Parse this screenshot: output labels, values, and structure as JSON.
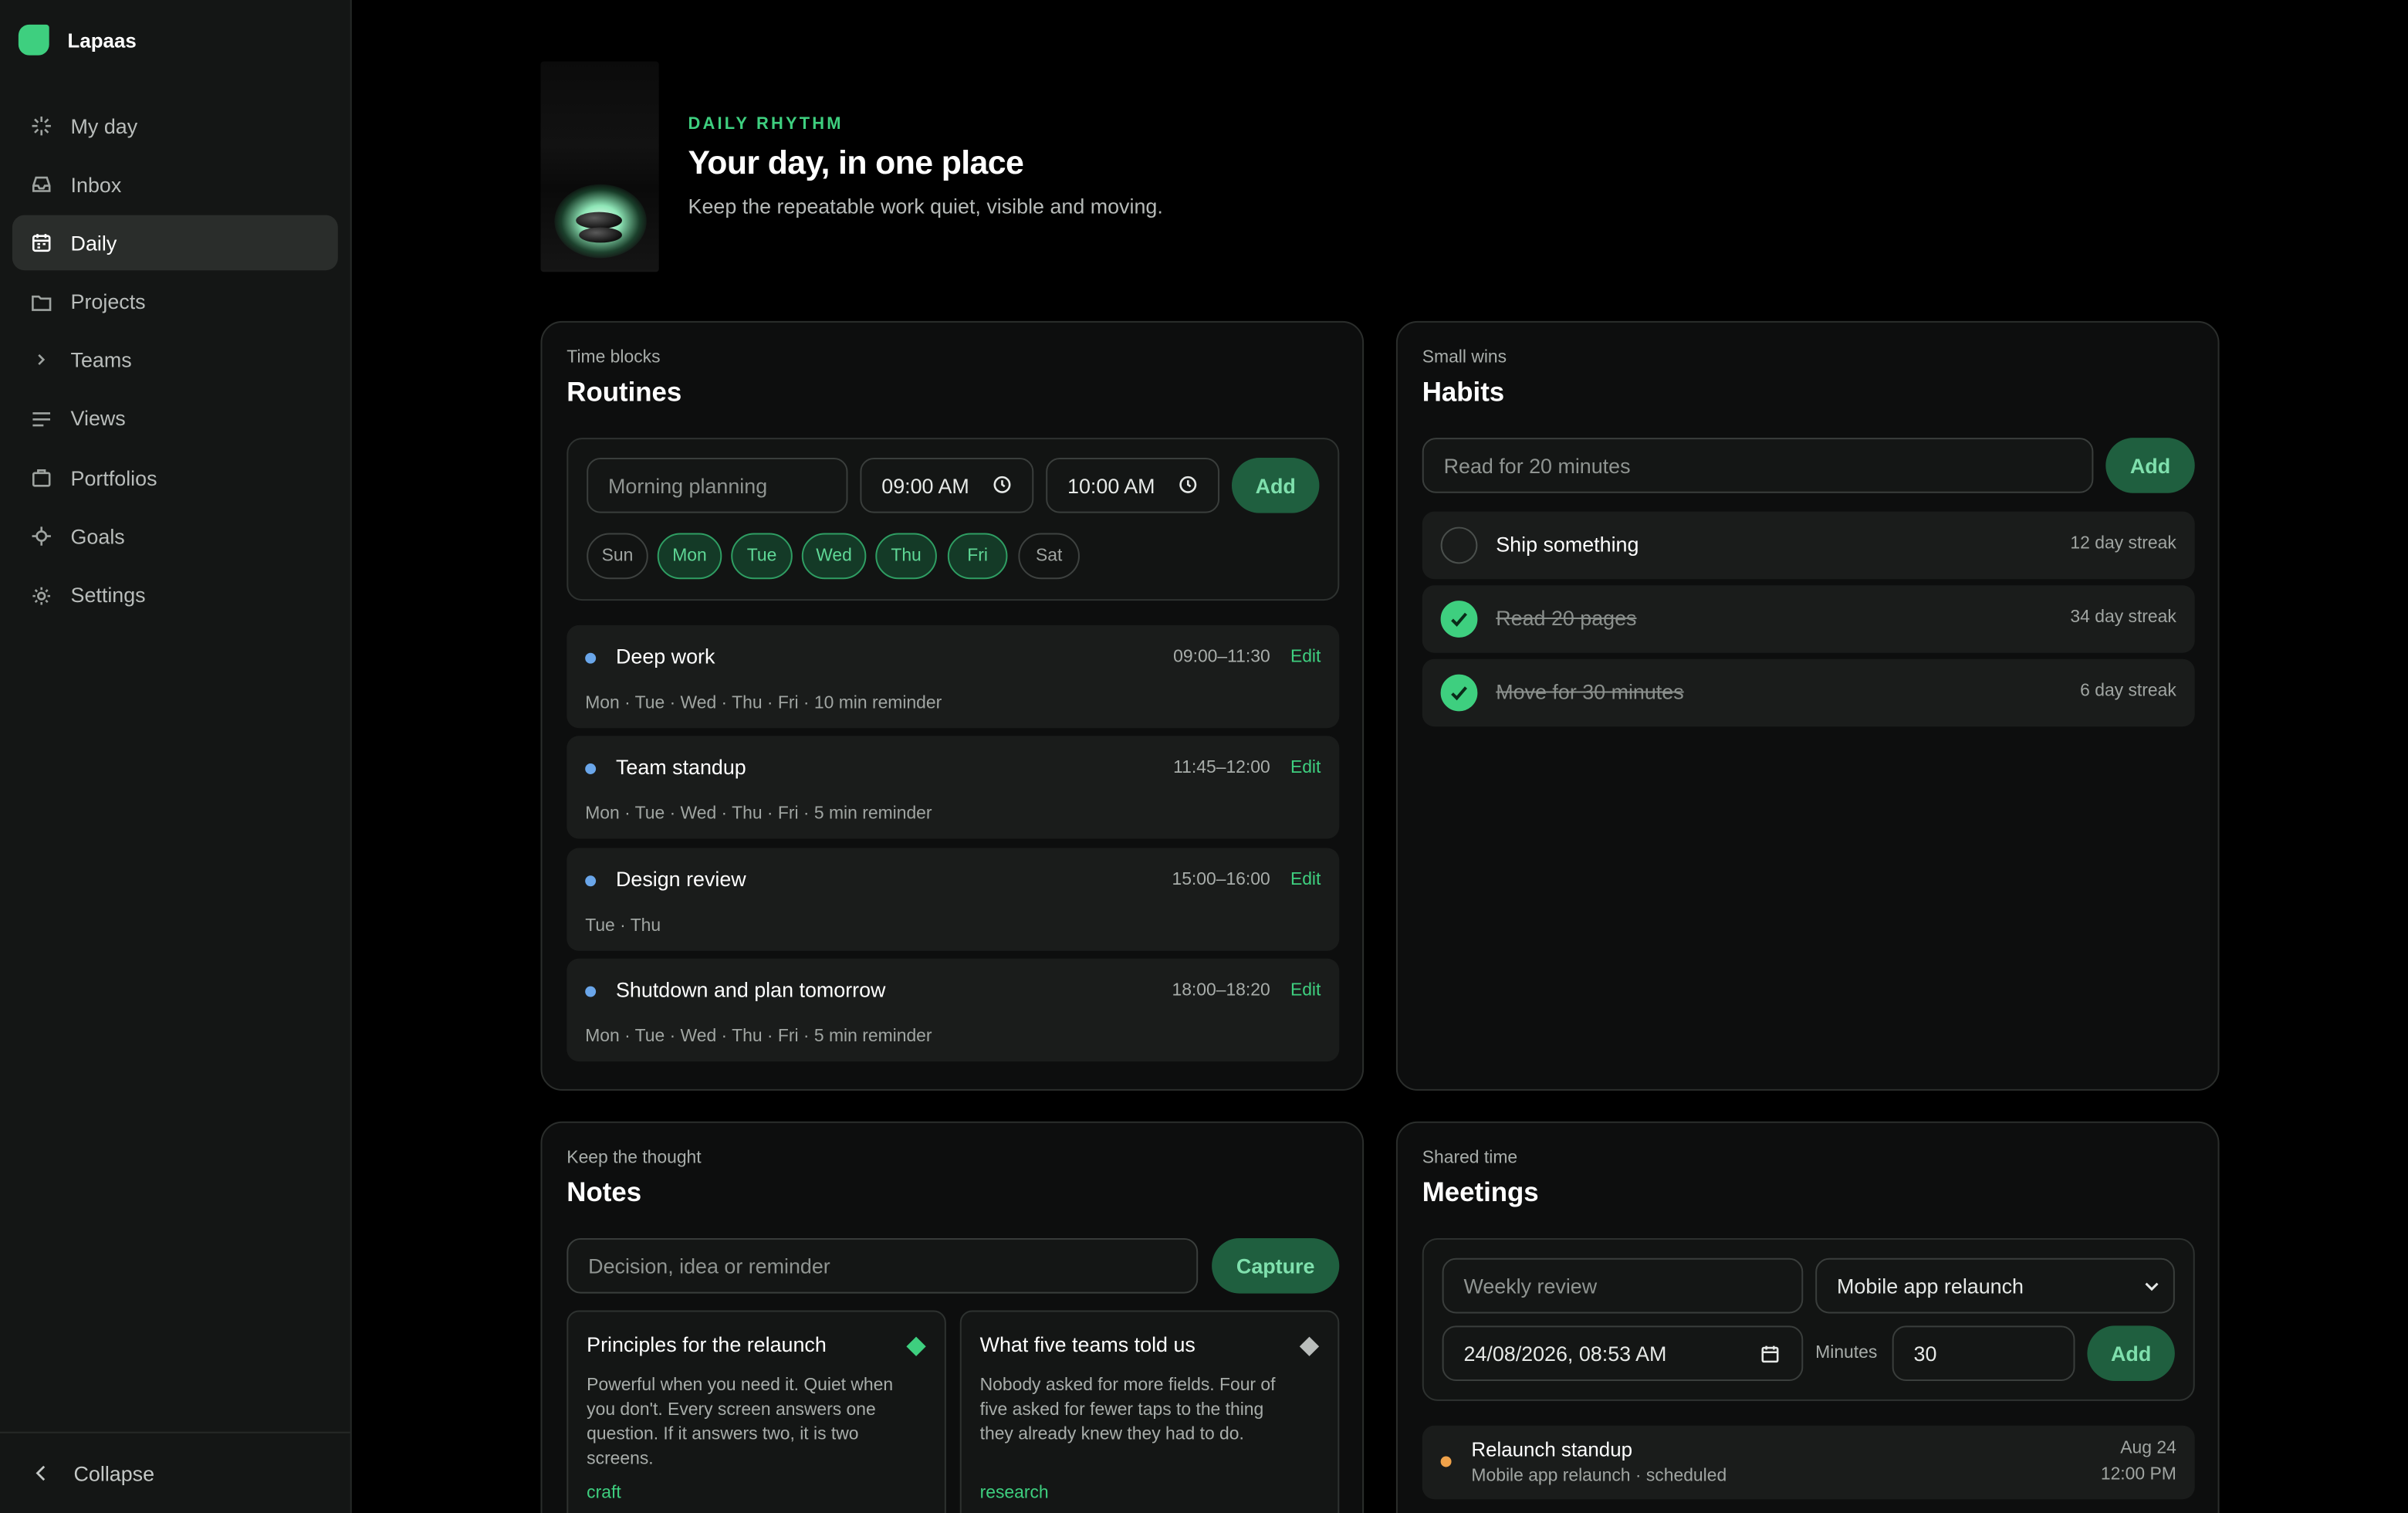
{
  "brand": {
    "name": "Lapaas"
  },
  "nav": [
    {
      "label": "My day",
      "icon": "sparkle-icon"
    },
    {
      "label": "Inbox",
      "icon": "inbox-icon"
    },
    {
      "label": "Daily",
      "icon": "calendar-icon",
      "active": true
    },
    {
      "label": "Projects",
      "icon": "folder-icon"
    },
    {
      "label": "Teams",
      "icon": "chevron-right-icon"
    },
    {
      "label": "Views",
      "icon": "lines-icon"
    },
    {
      "label": "Portfolios",
      "icon": "briefcase-icon"
    },
    {
      "label": "Goals",
      "icon": "target-icon"
    },
    {
      "label": "Settings",
      "icon": "gear-icon"
    }
  ],
  "collapse_label": "Collapse",
  "hero": {
    "eyebrow": "DAILY RHYTHM",
    "title": "Your day, in one place",
    "subtitle": "Keep the repeatable work quiet, visible and moving."
  },
  "routines": {
    "kicker": "Time blocks",
    "title": "Routines",
    "name_placeholder": "Morning planning",
    "start": "09:00 AM",
    "end": "10:00 AM",
    "add_label": "Add",
    "days": [
      {
        "label": "Sun",
        "on": false
      },
      {
        "label": "Mon",
        "on": true
      },
      {
        "label": "Tue",
        "on": true
      },
      {
        "label": "Wed",
        "on": true
      },
      {
        "label": "Thu",
        "on": true
      },
      {
        "label": "Fri",
        "on": true
      },
      {
        "label": "Sat",
        "on": false
      }
    ],
    "items": [
      {
        "name": "Deep work",
        "time": "09:00–11:30",
        "meta": "Mon · Tue · Wed · Thu · Fri · 10 min reminder",
        "edit": "Edit"
      },
      {
        "name": "Team standup",
        "time": "11:45–12:00",
        "meta": "Mon · Tue · Wed · Thu · Fri · 5 min reminder",
        "edit": "Edit"
      },
      {
        "name": "Design review",
        "time": "15:00–16:00",
        "meta": "Tue · Thu",
        "edit": "Edit"
      },
      {
        "name": "Shutdown and plan tomorrow",
        "time": "18:00–18:20",
        "meta": "Mon · Tue · Wed · Thu · Fri · 5 min reminder",
        "edit": "Edit"
      }
    ],
    "accent": "#6aa6ea"
  },
  "habits": {
    "kicker": "Small wins",
    "title": "Habits",
    "input_placeholder": "Read for 20 minutes",
    "add_label": "Add",
    "items": [
      {
        "name": "Ship something",
        "streak": "12 day streak",
        "done": false
      },
      {
        "name": "Read 20 pages",
        "streak": "34 day streak",
        "done": true
      },
      {
        "name": "Move for 30 minutes",
        "streak": "6 day streak",
        "done": true
      }
    ]
  },
  "notes": {
    "kicker": "Keep the thought",
    "title": "Notes",
    "input_placeholder": "Decision, idea or reminder",
    "capture_label": "Capture",
    "items": [
      {
        "title": "Principles for the relaunch",
        "body": "Powerful when you need it. Quiet when you don't. Every screen answers one question. If it answers two, it is two screens.",
        "tag": "craft",
        "color": "#3ecf7f"
      },
      {
        "title": "What five teams told us",
        "body": "Nobody asked for more fields. Four of five asked for fewer taps to the thing they already knew they had to do.",
        "tag": "research",
        "color": "#b9bdbb"
      }
    ]
  },
  "meetings": {
    "kicker": "Shared time",
    "title": "Meetings",
    "title_placeholder": "Weekly review",
    "project_select": "Mobile app relaunch",
    "datetime": "24/08/2026, 08:53 AM",
    "minutes_label": "Minutes",
    "minutes_value": "30",
    "add_label": "Add",
    "items": [
      {
        "name": "Relaunch standup",
        "sub": "Mobile app relaunch · scheduled",
        "date": "Aug 24",
        "time": "12:00 PM"
      }
    ]
  },
  "colors": {
    "accent": "#3ecf7f",
    "background": "#000000",
    "sidebar": "#141615"
  }
}
